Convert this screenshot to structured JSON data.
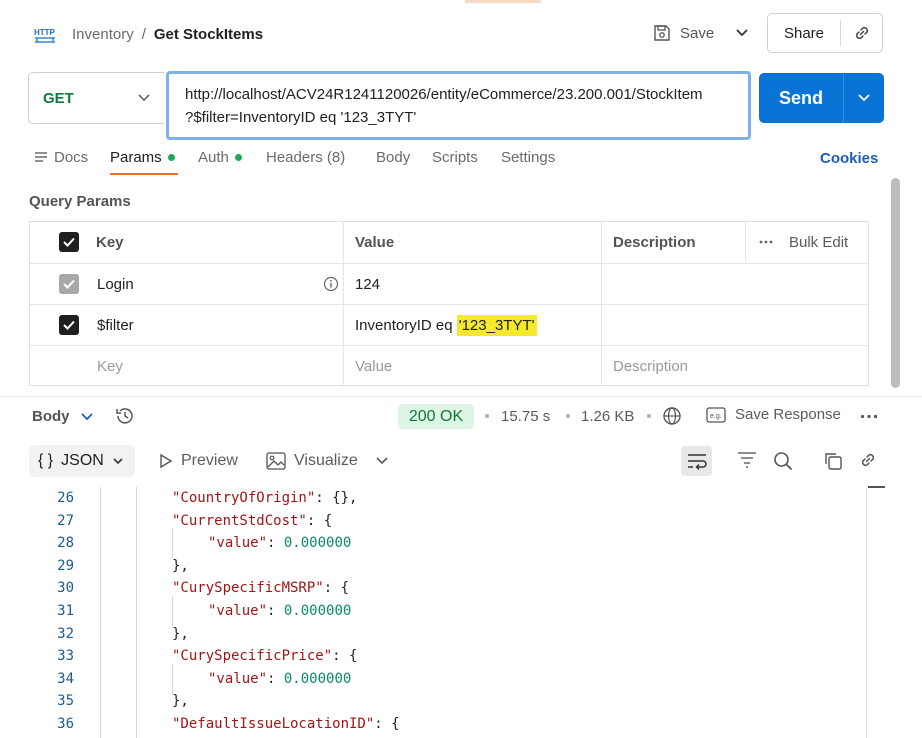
{
  "breadcrumb": {
    "parent": "Inventory",
    "separator": "/",
    "current": "Get StockItems"
  },
  "header": {
    "save_label": "Save",
    "share_label": "Share"
  },
  "request": {
    "method": "GET",
    "url_line1": "http://localhost/ACV24R1241120026/entity/eCommerce/23.200.001/StockItem",
    "url_line2": "?$filter=InventoryID eq '123_3TYT'",
    "send_label": "Send"
  },
  "request_tabs": [
    {
      "label": "Docs"
    },
    {
      "label": "Params"
    },
    {
      "label": "Auth"
    },
    {
      "label": "Headers (8)"
    },
    {
      "label": "Body"
    },
    {
      "label": "Scripts"
    },
    {
      "label": "Settings"
    }
  ],
  "cookies_label": "Cookies",
  "query_params": {
    "title": "Query Params",
    "headers": {
      "key": "Key",
      "value": "Value",
      "description": "Description",
      "bulk_edit": "Bulk Edit"
    },
    "rows": [
      {
        "key": "Login",
        "value": "124",
        "description": "",
        "checked": true,
        "disabled": true
      },
      {
        "key": "$filter",
        "value_prefix": "InventoryID eq ",
        "value_highlight": "'123_3TYT'",
        "description": "",
        "checked": true,
        "disabled": false
      }
    ],
    "placeholder": {
      "key": "Key",
      "value": "Value",
      "description": "Description"
    }
  },
  "response": {
    "body_label": "Body",
    "status": "200 OK",
    "time": "15.75 s",
    "size": "1.26 KB",
    "save_response": "Save Response",
    "format": "JSON",
    "format_braces": "{ }",
    "preview": "Preview",
    "visualize": "Visualize"
  },
  "code_lines": [
    {
      "n": "26",
      "parts": [
        [
          "key",
          "\"CountryOfOrigin\""
        ],
        [
          "pun",
          ": {},"
        ]
      ]
    },
    {
      "n": "27",
      "parts": [
        [
          "key",
          "\"CurrentStdCost\""
        ],
        [
          "pun",
          ": {"
        ]
      ]
    },
    {
      "n": "28",
      "parts": [
        [
          "key",
          "\"value\""
        ],
        [
          "pun",
          ": "
        ],
        [
          "num",
          "0.000000"
        ]
      ]
    },
    {
      "n": "29",
      "parts": [
        [
          "pun",
          "},"
        ]
      ]
    },
    {
      "n": "30",
      "parts": [
        [
          "key",
          "\"CurySpecificMSRP\""
        ],
        [
          "pun",
          ": {"
        ]
      ]
    },
    {
      "n": "31",
      "parts": [
        [
          "key",
          "\"value\""
        ],
        [
          "pun",
          ": "
        ],
        [
          "num",
          "0.000000"
        ]
      ]
    },
    {
      "n": "32",
      "parts": [
        [
          "pun",
          "},"
        ]
      ]
    },
    {
      "n": "33",
      "parts": [
        [
          "key",
          "\"CurySpecificPrice\""
        ],
        [
          "pun",
          ": {"
        ]
      ]
    },
    {
      "n": "34",
      "parts": [
        [
          "key",
          "\"value\""
        ],
        [
          "pun",
          ": "
        ],
        [
          "num",
          "0.000000"
        ]
      ]
    },
    {
      "n": "35",
      "parts": [
        [
          "pun",
          "},"
        ]
      ]
    },
    {
      "n": "36",
      "parts": [
        [
          "key",
          "\"DefaultIssueLocationID\""
        ],
        [
          "pun",
          ": {"
        ]
      ]
    }
  ],
  "colors": {
    "send": "#0a74d6",
    "method": "#0e7a3a",
    "highlight": "#f6e82a",
    "status_bg": "#dff5e6",
    "active_tab": "#f26b3a"
  }
}
